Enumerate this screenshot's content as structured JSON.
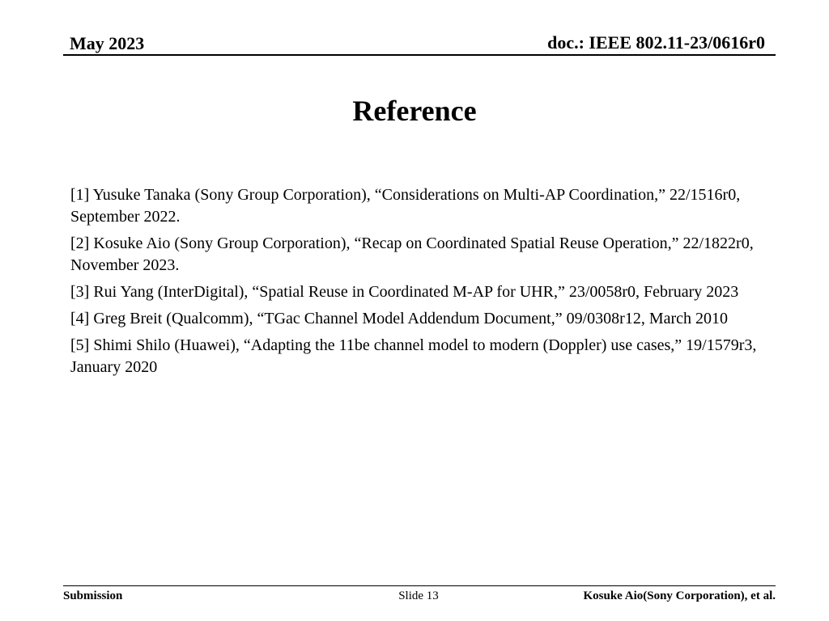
{
  "header": {
    "date": "May 2023",
    "doc_id": "doc.: IEEE 802.11-23/0616r0"
  },
  "slide": {
    "title": "Reference",
    "references": [
      "[1] Yusuke Tanaka (Sony Group Corporation), “Considerations on Multi-AP Coordination,” 22/1516r0, September 2022.",
      "[2] Kosuke Aio (Sony Group Corporation), “Recap on Coordinated Spatial Reuse Operation,” 22/1822r0, November 2023.",
      "[3] Rui Yang (InterDigital), “Spatial Reuse in Coordinated M-AP for UHR,”  23/0058r0, February 2023",
      "[4] Greg Breit (Qualcomm), “TGac Channel Model Addendum Document,” 09/0308r12, March 2010",
      "[5] Shimi Shilo (Huawei), “Adapting the 11be channel model to modern (Doppler) use cases,” 19/1579r3, January 2020"
    ]
  },
  "footer": {
    "left": "Submission",
    "center": "Slide 13",
    "right": "Kosuke Aio(Sony Corporation), et al."
  }
}
